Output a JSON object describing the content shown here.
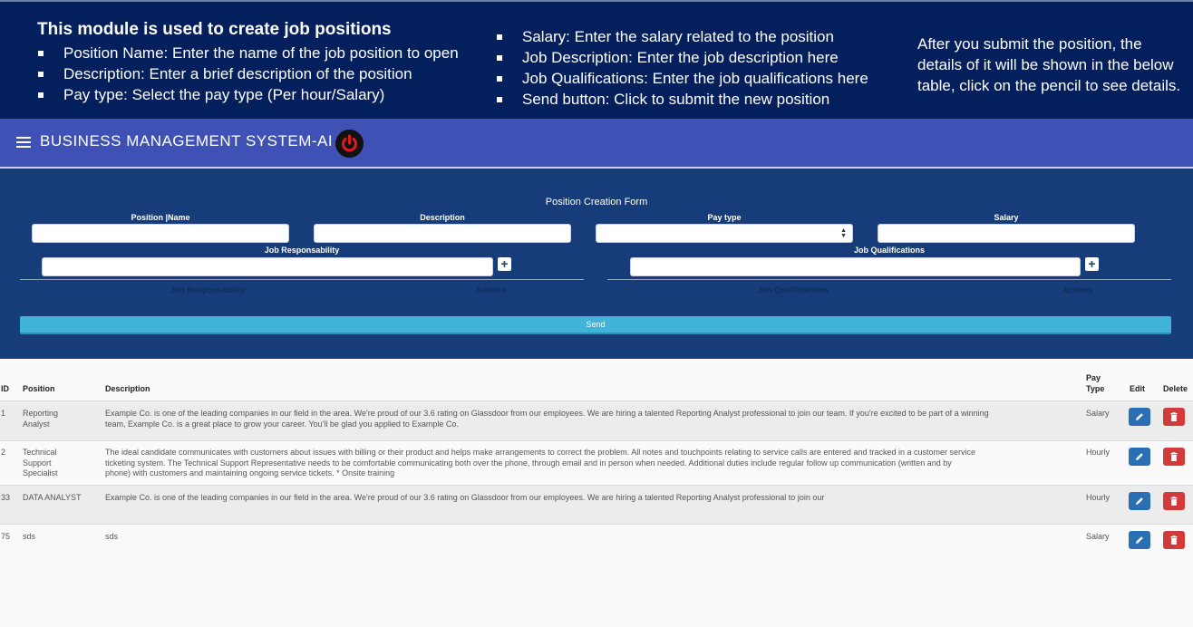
{
  "banner": {
    "title": "This module is used to create job positions",
    "col1": [
      "Position Name: Enter the name of the job position to open",
      "Description: Enter a brief description of the position",
      "Pay type: Select the pay type (Per hour/Salary)"
    ],
    "col2": [
      "Salary: Enter the salary related to the position",
      "Job Description: Enter the job description here",
      "Job Qualifications: Enter the job qualifications here",
      "Send button: Click to submit the new position"
    ],
    "note": "After you submit the position, the details of it will be shown in the below table, click on the pencil to see details."
  },
  "appbar": {
    "title": "BUSINESS MANAGEMENT SYSTEM-AI",
    "menu_icon": "hamburger-menu-icon",
    "power_icon": "power-icon",
    "power_color": "#e01b1b"
  },
  "form": {
    "title": "Position Creation Form",
    "labels": {
      "position_name": "Position |Name",
      "description": "Description",
      "pay_type": "Pay type",
      "salary": "Salary",
      "job_responsability": "Job Responsability",
      "job_qualifications": "Job Qualifications"
    },
    "values": {
      "position_name": "",
      "description": "",
      "pay_type": "",
      "salary": "",
      "job_responsability": "",
      "job_qualifications": ""
    },
    "resp_table_headers": [
      "Job Responsability",
      "Actions"
    ],
    "qual_table_headers": [
      "Job Qualifications",
      "Actions"
    ],
    "send_label": "Send"
  },
  "table": {
    "headers": {
      "id": "ID",
      "position": "Position",
      "description": "Description",
      "pay_type_line1": "Pay",
      "pay_type_line2": "Type",
      "edit": "Edit",
      "delete": "Delete"
    },
    "rows": [
      {
        "id": "1",
        "position": [
          "Reporting",
          "Analyst"
        ],
        "description": [
          "Example Co. is one of the leading companies in our field in the area. We're proud of our 3.6 rating on Glassdoor from our employees. We are hiring a talented Reporting Analyst professional to join our team. If you're excited to be part of a winning",
          "team, Example Co. is a great place to grow your career. You'll be glad you applied to Example Co."
        ],
        "pay_type": "Salary"
      },
      {
        "id": "2",
        "position": [
          "Technical",
          "Support",
          "Specialist"
        ],
        "description": [
          "The ideal candidate communicates with customers about issues with billing or their product and helps make arrangements to correct the problem. All notes and touchpoints relating to service calls are entered and tracked in a customer service",
          "ticketing system. The Technical Support Representative needs to be comfortable communicating both over the phone, through email and in person when needed. Additional duties include regular follow up communication (written and by",
          "phone) with customers and maintaining ongoing service tickets. * Onsite training"
        ],
        "pay_type": "Hourly"
      },
      {
        "id": "33",
        "position": [
          "DATA ANALYST"
        ],
        "description": [
          "Example Co. is one of the leading companies in our field in the area. We're proud of our 3.6 rating on Glassdoor from our employees. We are hiring a talented Reporting Analyst professional to join our"
        ],
        "pay_type": "Hourly"
      },
      {
        "id": "75",
        "position": [
          "sds"
        ],
        "description": [
          "sds"
        ],
        "pay_type": "Salary"
      }
    ],
    "edit_icon": "pencil-icon",
    "delete_icon": "trash-icon",
    "edit_color": "#2a6fb3",
    "delete_color": "#d33b3b"
  }
}
